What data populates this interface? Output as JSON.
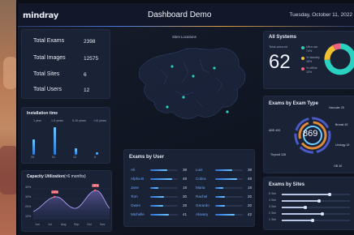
{
  "header": {
    "logo": "mindray",
    "title": "Dashboard Demo",
    "datetime": "Tuesday, October 11, 2022"
  },
  "stats": {
    "rows": [
      {
        "label": "Total Exams",
        "value": "2398"
      },
      {
        "label": "Total Images",
        "value": "12575"
      },
      {
        "label": "Total Sites",
        "value": "6"
      },
      {
        "label": "Total Users",
        "value": "12"
      }
    ]
  },
  "installation": {
    "title": "Installation time",
    "legend": [
      "1 year",
      "1-5 years",
      "5-10 years",
      ">10 years"
    ],
    "bars": [
      {
        "label": "29",
        "value": 29
      },
      {
        "label": "51",
        "value": 51
      },
      {
        "label": "12",
        "value": 12
      },
      {
        "label": "5",
        "value": 5
      }
    ]
  },
  "capacity": {
    "title": "Capacity Utilization",
    "subtitle": "(≈6 months)",
    "ylabels": [
      "40%",
      "30%",
      "20%",
      "10%"
    ],
    "xlabels": [
      "Jun",
      "Jul",
      "Aug",
      "Sep",
      "Oct",
      "Nov"
    ],
    "tag_a": "24%",
    "tag_b": "18%"
  },
  "map": {
    "title": "Sites Locations"
  },
  "all_systems": {
    "title": "All Systems",
    "total_label": "Total amount",
    "total_value": "62",
    "legend": [
      {
        "name": "Ultra use",
        "pct": "74%",
        "color": "#2ad0c0"
      },
      {
        "name": "% standby",
        "pct": "18%",
        "color": "#f0c030"
      },
      {
        "name": "% offline",
        "pct": "10%",
        "color": "#f06080"
      }
    ]
  },
  "exam_type": {
    "title": "Exams by Exam Type",
    "center_value": "869",
    "labels": [
      {
        "name": "Vascular",
        "value": "25"
      },
      {
        "name": "Breast",
        "value": "45"
      },
      {
        "name": "Urology",
        "value": "15"
      },
      {
        "name": "OB",
        "value": "40"
      },
      {
        "name": "Thyroid",
        "value": "128"
      },
      {
        "name": "ABD",
        "value": "400"
      }
    ]
  },
  "users": {
    "title": "Exams by User",
    "left": [
      {
        "name": "Ali",
        "value": "38",
        "fill": 0.62
      },
      {
        "name": "Alpha B",
        "value": "48",
        "fill": 0.78
      },
      {
        "name": "Jane",
        "value": "18",
        "fill": 0.3
      },
      {
        "name": "Tom",
        "value": "30",
        "fill": 0.5
      },
      {
        "name": "Owen",
        "value": "28",
        "fill": 0.46
      },
      {
        "name": "Michelle",
        "value": "41",
        "fill": 0.68
      }
    ],
    "right": [
      {
        "name": "Luis",
        "value": "38",
        "fill": 0.62
      },
      {
        "name": "Cobra",
        "value": "48",
        "fill": 0.78
      },
      {
        "name": "Maria",
        "value": "18",
        "fill": 0.3
      },
      {
        "name": "Rachel",
        "value": "20",
        "fill": 0.34
      },
      {
        "name": "Gerardo",
        "value": "20",
        "fill": 0.34
      },
      {
        "name": "Alavary",
        "value": "42",
        "fill": 0.7
      }
    ]
  },
  "sites": {
    "title": "Exams by Sites",
    "rows": [
      {
        "label": "5 Site",
        "fill": 0.7
      },
      {
        "label": "4 Site",
        "fill": 0.55
      },
      {
        "label": "3 Site",
        "fill": 0.35
      },
      {
        "label": "2 Site",
        "fill": 0.6
      },
      {
        "label": "1 Site",
        "fill": 0.45
      }
    ]
  },
  "colors": {
    "accent": "#4a8cff",
    "cyan": "#2ad0c0",
    "yellow": "#f0c030",
    "pink": "#f06080"
  }
}
